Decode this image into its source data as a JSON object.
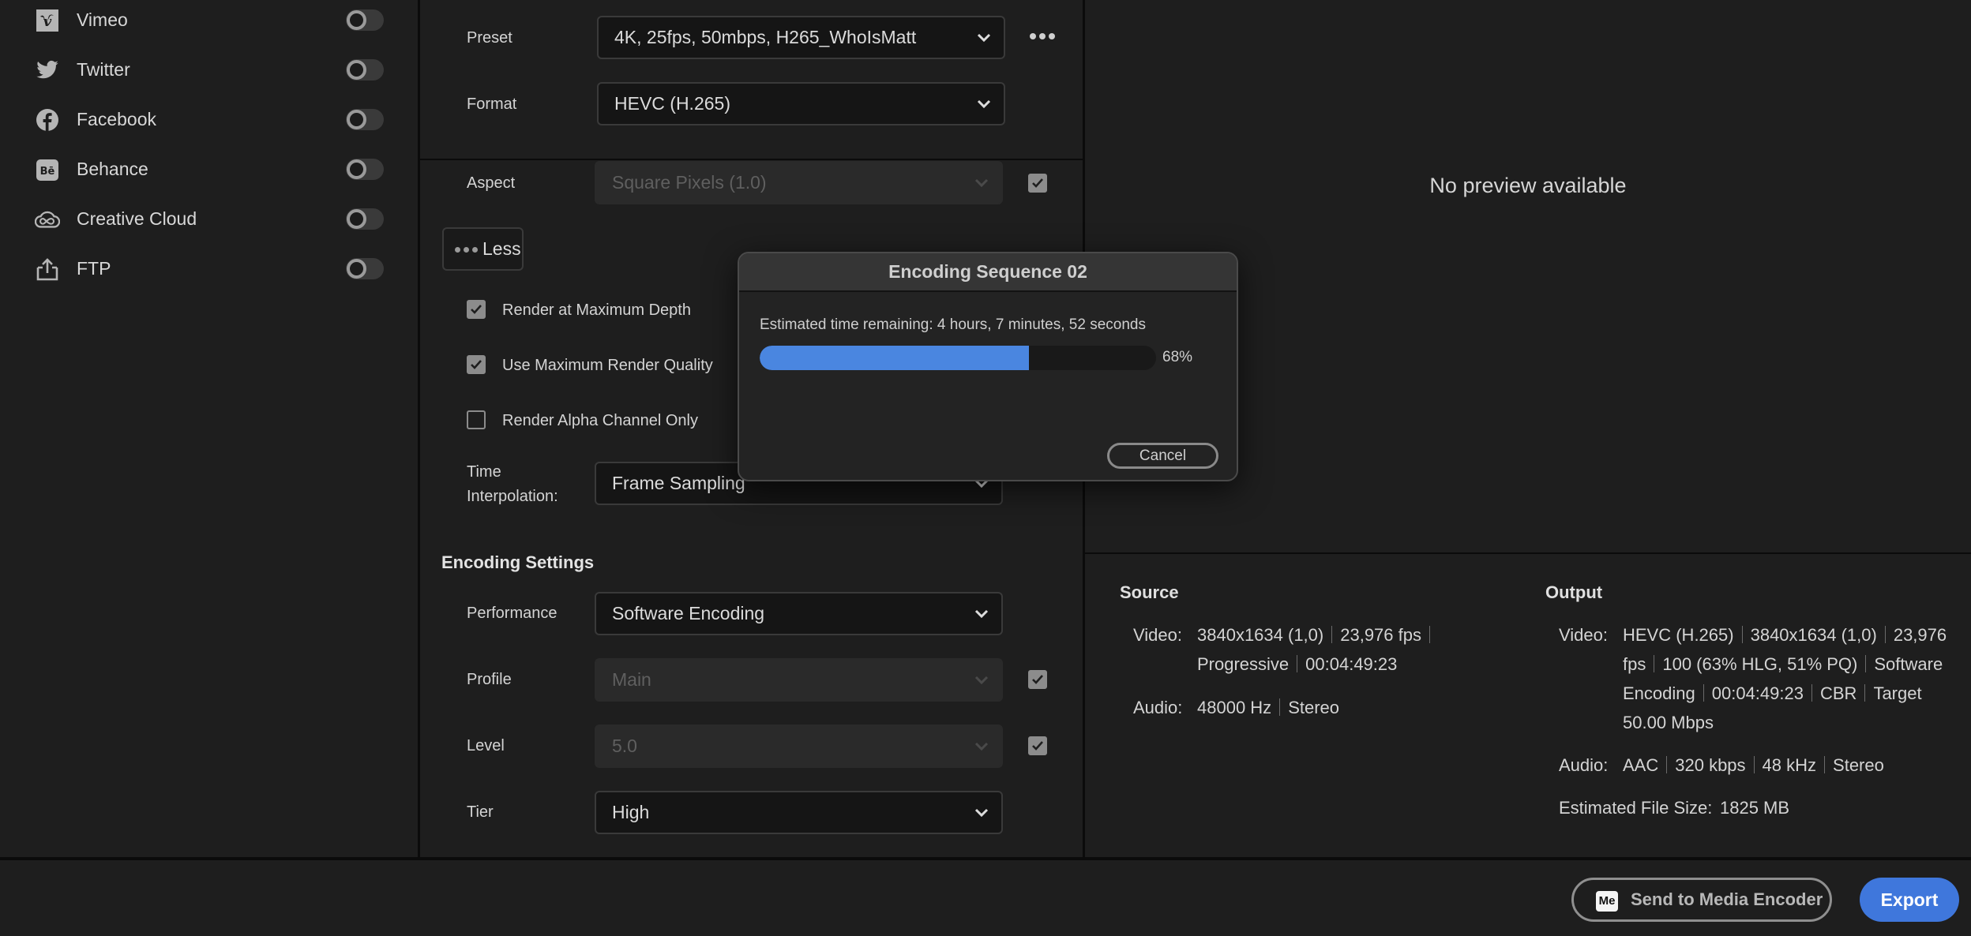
{
  "destinations": [
    {
      "label": "Vimeo",
      "icon": "vimeo-icon",
      "enabled": false
    },
    {
      "label": "Twitter",
      "icon": "twitter-icon",
      "enabled": false
    },
    {
      "label": "Facebook",
      "icon": "facebook-icon",
      "enabled": false
    },
    {
      "label": "Behance",
      "icon": "behance-icon",
      "enabled": false
    },
    {
      "label": "Creative Cloud",
      "icon": "creative-cloud-icon",
      "enabled": false
    },
    {
      "label": "FTP",
      "icon": "upload-icon",
      "enabled": false
    }
  ],
  "settings": {
    "preset": {
      "label": "Preset",
      "value": "4K, 25fps, 50mbps, H265_WhoIsMatt"
    },
    "format": {
      "label": "Format",
      "value": "HEVC (H.265)"
    },
    "aspect": {
      "label": "Aspect",
      "value": "Square Pixels (1.0)",
      "disabled": true,
      "locked": true
    },
    "less_label": "Less",
    "checkboxes": [
      {
        "label": "Render at Maximum Depth",
        "checked": true
      },
      {
        "label": "Use Maximum Render Quality",
        "checked": true
      },
      {
        "label": "Render Alpha Channel Only",
        "checked": false
      }
    ],
    "time_interpolation": {
      "label_line1": "Time",
      "label_line2": "Interpolation:",
      "value": "Frame Sampling"
    }
  },
  "encoding": {
    "heading": "Encoding Settings",
    "performance": {
      "label": "Performance",
      "value": "Software Encoding"
    },
    "profile": {
      "label": "Profile",
      "value": "Main",
      "disabled": true,
      "locked": true
    },
    "level": {
      "label": "Level",
      "value": "5.0",
      "disabled": true,
      "locked": true
    },
    "tier": {
      "label": "Tier",
      "value": "High"
    }
  },
  "preview": {
    "empty_text": "No preview available"
  },
  "summary": {
    "source": {
      "heading": "Source",
      "video_key": "Video:",
      "video_line1": [
        "3840x1634 (1,0)",
        "23,976 fps",
        ""
      ],
      "video_line2": [
        "Progressive",
        "00:04:49:23"
      ],
      "audio_key": "Audio:",
      "audio": [
        "48000 Hz",
        "Stereo"
      ]
    },
    "output": {
      "heading": "Output",
      "video_key": "Video:",
      "video_line1": [
        "HEVC (H.265)",
        "3840x1634 (1,0)",
        "23,976"
      ],
      "video_line2": [
        "fps",
        "100 (63% HLG, 51% PQ)",
        "Software"
      ],
      "video_line3": [
        "Encoding",
        "00:04:49:23",
        "CBR",
        "Target"
      ],
      "video_line4": "50.00 Mbps",
      "audio_key": "Audio:",
      "audio": [
        "AAC",
        "320 kbps",
        "48 kHz",
        "Stereo"
      ],
      "filesize_key": "Estimated File Size:",
      "filesize_value": "1825 MB"
    }
  },
  "dialog": {
    "title": "Encoding Sequence 02",
    "eta": "Estimated time remaining: 4 hours, 7 minutes, 52 seconds",
    "progress": 0.68,
    "progress_label": "68%",
    "cancel_label": "Cancel",
    "accent": "#4a86e0"
  },
  "footer": {
    "send_label": "Send to Media Encoder",
    "send_icon_text": "Me",
    "export_label": "Export",
    "export_color": "#3f77dc"
  }
}
